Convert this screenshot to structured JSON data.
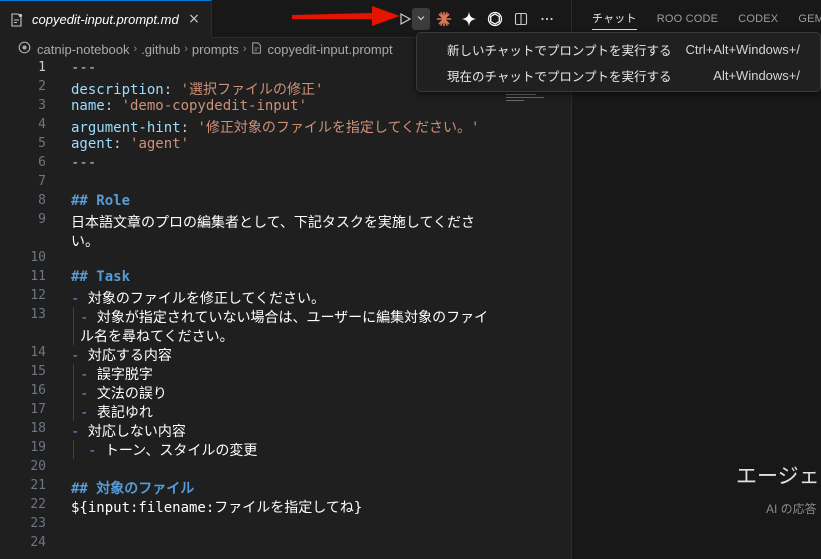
{
  "tab": {
    "title": "copyedit-input.prompt.md",
    "close": "×"
  },
  "toolbar": {
    "run_icon": "play-icon",
    "dropdown_icon": "chevron-down-icon",
    "icons": [
      "claude-icon",
      "sparkle-icon",
      "openai-icon",
      "split-editor-icon",
      "more-icon"
    ]
  },
  "breadcrumb": {
    "items": [
      "catnip-notebook",
      ".github",
      "prompts",
      "copyedit-input.prompt"
    ]
  },
  "editor": {
    "line_numbers": [
      "1",
      "2",
      "3",
      "4",
      "5",
      "6",
      "7",
      "8",
      "9",
      "",
      "10",
      "11",
      "12",
      "13",
      "",
      "14",
      "15",
      "16",
      "17",
      "18",
      "19",
      "20",
      "21",
      "22",
      "23",
      "24"
    ],
    "fm_delim": "---",
    "fm": [
      {
        "key": "description",
        "value": "'選択ファイルの修正'"
      },
      {
        "key": "name",
        "value": "'demo-copydedit-input'"
      },
      {
        "key": "argument-hint",
        "value": "'修正対象のファイルを指定してください。'"
      },
      {
        "key": "agent",
        "value": "'agent'"
      }
    ],
    "role_heading": "## Role",
    "role_text_1": "日本語文章のプロの編集者として、下記タスクを実施してくださ",
    "role_text_2": "い。",
    "task_heading": "## Task",
    "bullet": "-",
    "task": {
      "l12": "対象のファイルを修正してください。",
      "l13a": "対象が指定されていない場合は、ユーザーに編集対象のファイ",
      "l13b": "ル名を尋ねてください。",
      "l14": "対応する内容",
      "l15": "誤字脱字",
      "l16": "文法の誤り",
      "l17": "表記ゆれ",
      "l18": "対応しない内容",
      "l19": "トーン、スタイルの変更"
    },
    "file_heading": "## 対象のファイル",
    "input_var": "${input:filename:ファイルを指定してね}"
  },
  "right_panel": {
    "tabs": [
      "チャット",
      "ROO CODE",
      "CODEX",
      "GEMINI"
    ],
    "agent_title": "エージェン",
    "agent_sub": "AI の応答"
  },
  "menu": {
    "items": [
      {
        "label": "新しいチャットでプロンプトを実行する",
        "shortcut": "Ctrl+Alt+Windows+/"
      },
      {
        "label": "現在のチャットでプロンプトを実行する",
        "shortcut": "Alt+Windows+/"
      }
    ]
  },
  "colors": {
    "accent": "#0078d4",
    "annotation": "#e51400",
    "key": "#9cdcfe",
    "string": "#ce9178",
    "heading": "#569cd6"
  }
}
